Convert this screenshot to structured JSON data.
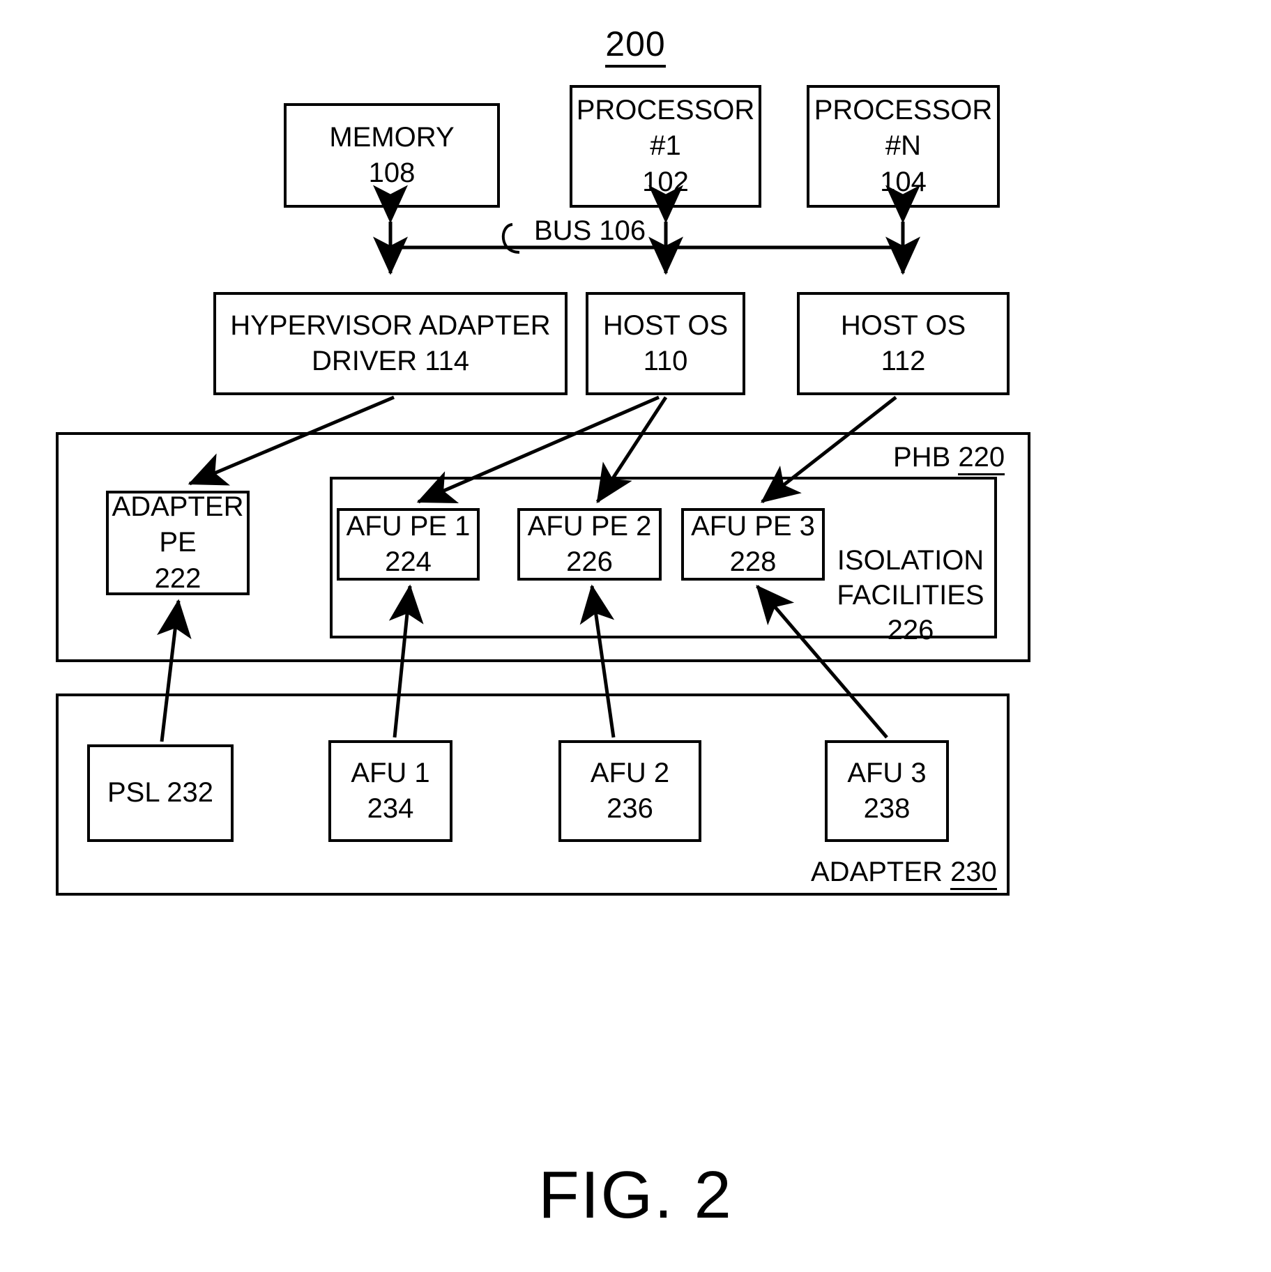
{
  "figure": {
    "number": "200",
    "caption": "FIG. 2"
  },
  "top_row": {
    "memory": {
      "line1": "MEMORY",
      "line2": "108"
    },
    "processor_1": {
      "line1": "PROCESSOR",
      "line2": "#1",
      "line3": "102"
    },
    "processor_n": {
      "line1": "PROCESSOR",
      "line2": "#N",
      "line3": "104"
    }
  },
  "bus": {
    "label": "BUS 106"
  },
  "os_row": {
    "hypervisor": {
      "line1": "HYPERVISOR ADAPTER",
      "line2": "DRIVER 114"
    },
    "host_os_110": {
      "line1": "HOST OS",
      "line2": "110"
    },
    "host_os_112": {
      "line1": "HOST OS",
      "line2": "112"
    }
  },
  "phb": {
    "label_text": "PHB",
    "label_ref": "220",
    "adapter_pe": {
      "line1": "ADAPTER",
      "line2": "PE",
      "line3": "222"
    },
    "isolation": {
      "line1": "ISOLATION",
      "line2": "FACILITIES",
      "line3": "226"
    },
    "pes": [
      {
        "line1": "AFU PE 1",
        "line2": "224"
      },
      {
        "line1": "AFU PE 2",
        "line2": "226"
      },
      {
        "line1": "AFU PE 3",
        "line2": "228"
      }
    ]
  },
  "adapter": {
    "label_text": "ADAPTER",
    "label_ref": "230",
    "units": [
      {
        "line1": "PSL 232",
        "line2": ""
      },
      {
        "line1": "AFU 1",
        "line2": "234"
      },
      {
        "line1": "AFU 2",
        "line2": "236"
      },
      {
        "line1": "AFU 3",
        "line2": "238"
      }
    ]
  }
}
